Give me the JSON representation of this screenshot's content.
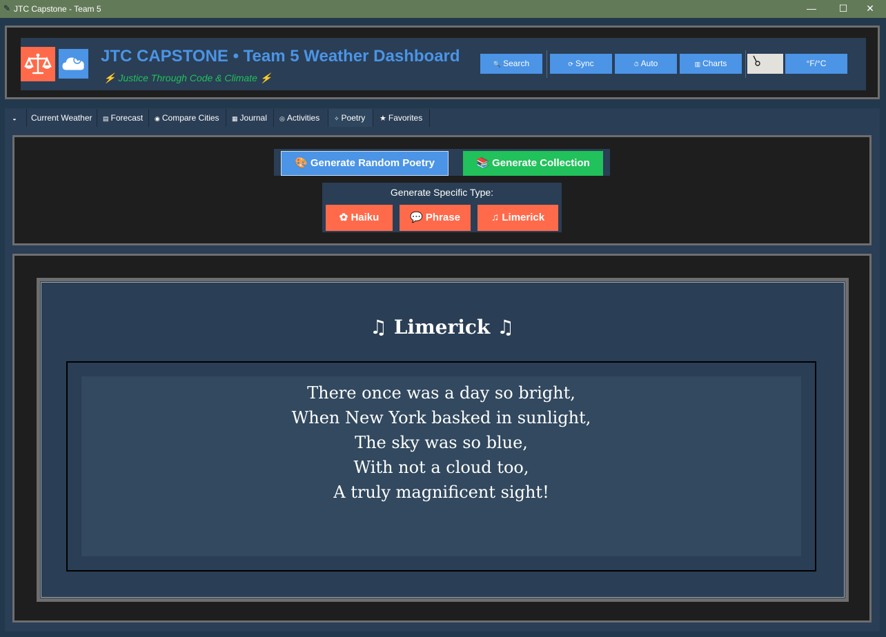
{
  "window": {
    "title": "JTC Capstone - Team 5",
    "controls": {
      "minimize": "—",
      "maximize": "☐",
      "close": "✕"
    }
  },
  "header": {
    "title": "JTC CAPSTONE • Team 5 Weather Dashboard",
    "subtitle": "⚡ Justice Through Code & Climate ⚡",
    "logo_icons": [
      "scales-icon",
      "cloud-icon"
    ],
    "buttons": {
      "search": "Search",
      "sync": "Sync",
      "auto": "Auto",
      "charts": "Charts",
      "units": "°F/°C"
    },
    "thermometer_icon": "thermometer-icon"
  },
  "tabs": [
    {
      "label": "",
      "icon": "weather-icon"
    },
    {
      "label": "Current Weather",
      "icon": ""
    },
    {
      "label": "Forecast",
      "icon": "calendar-icon"
    },
    {
      "label": "Compare Cities",
      "icon": "globe-icon"
    },
    {
      "label": "Journal",
      "icon": "journal-icon"
    },
    {
      "label": "Activities",
      "icon": "activity-icon"
    },
    {
      "label": "Poetry",
      "icon": "poetry-icon",
      "active": true
    },
    {
      "label": "Favorites",
      "icon": "star-icon"
    }
  ],
  "poetry": {
    "generate_random": "Generate Random Poetry",
    "generate_collection": "Generate Collection",
    "specific_type_label": "Generate Specific Type:",
    "types": {
      "haiku": "Haiku",
      "phrase": "Phrase",
      "limerick": "Limerick"
    },
    "current": {
      "title": "♫ Limerick ♫",
      "lines": [
        "There once was a day so bright,",
        "When New York basked in sunlight,",
        "The sky was so blue,",
        "With not a cloud too,",
        "A truly magnificent sight!"
      ]
    }
  },
  "colors": {
    "accent_blue": "#4b94e6",
    "accent_green": "#21c15b",
    "accent_orange": "#ff6a4a",
    "panel": "#2a3e55",
    "dark": "#1e1e1e"
  }
}
